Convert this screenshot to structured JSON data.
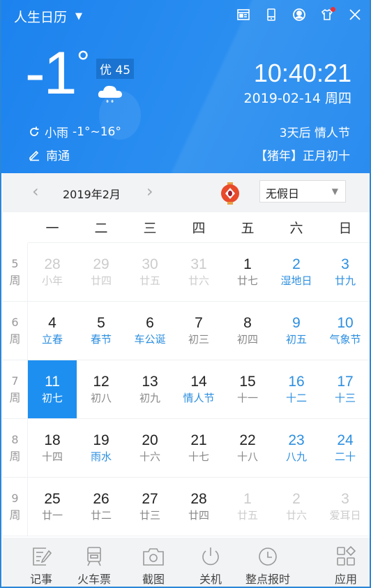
{
  "app": {
    "title": "人生日历",
    "menu_icon": "dropdown-triangle-icon"
  },
  "top_icons": [
    "news-icon",
    "mobile-icon",
    "user-icon",
    "skin-shirt-icon",
    "close-icon"
  ],
  "weather": {
    "temperature": "-1",
    "degree_symbol": "°",
    "aqi": "优 45",
    "condition": "小雨",
    "range": "-1°~16°",
    "location": "南通",
    "icon": "cloud-rain-icon"
  },
  "clock": {
    "time": "10:40:21",
    "date": "2019-02-14 周四",
    "upcoming": "3天后 情人节",
    "lunar": "【猪年】正月初十"
  },
  "nav": {
    "prev_label": "‹",
    "next_label": "›",
    "month": "2019年2月",
    "holiday_select": "无假日",
    "holiday_arrow": "▼"
  },
  "weekdays": [
    "一",
    "二",
    "三",
    "四",
    "五",
    "六",
    "日"
  ],
  "week_suffix": "周",
  "weeks": [
    {
      "num": "5",
      "days": [
        {
          "d": "28",
          "l": "小年",
          "t": "other"
        },
        {
          "d": "29",
          "l": "廿四",
          "t": "other"
        },
        {
          "d": "30",
          "l": "廿五",
          "t": "other"
        },
        {
          "d": "31",
          "l": "廿六",
          "t": "other"
        },
        {
          "d": "1",
          "l": "廿七",
          "t": "cur"
        },
        {
          "d": "2",
          "l": "湿地日",
          "t": "wkend"
        },
        {
          "d": "3",
          "l": "廿九",
          "t": "wkend"
        }
      ]
    },
    {
      "num": "6",
      "days": [
        {
          "d": "4",
          "l": "立春",
          "t": "cur fest"
        },
        {
          "d": "5",
          "l": "春节",
          "t": "cur fest"
        },
        {
          "d": "6",
          "l": "车公诞",
          "t": "cur fest"
        },
        {
          "d": "7",
          "l": "初三",
          "t": "cur"
        },
        {
          "d": "8",
          "l": "初四",
          "t": "cur"
        },
        {
          "d": "9",
          "l": "初五",
          "t": "wkend"
        },
        {
          "d": "10",
          "l": "气象节",
          "t": "wkend"
        }
      ]
    },
    {
      "num": "7",
      "days": [
        {
          "d": "11",
          "l": "初七",
          "t": "cur sel"
        },
        {
          "d": "12",
          "l": "初八",
          "t": "cur"
        },
        {
          "d": "13",
          "l": "初九",
          "t": "cur"
        },
        {
          "d": "14",
          "l": "情人节",
          "t": "cur fest"
        },
        {
          "d": "15",
          "l": "十一",
          "t": "cur"
        },
        {
          "d": "16",
          "l": "十二",
          "t": "wkend"
        },
        {
          "d": "17",
          "l": "十三",
          "t": "wkend"
        }
      ]
    },
    {
      "num": "8",
      "days": [
        {
          "d": "18",
          "l": "十四",
          "t": "cur"
        },
        {
          "d": "19",
          "l": "雨水",
          "t": "cur fest"
        },
        {
          "d": "20",
          "l": "十六",
          "t": "cur"
        },
        {
          "d": "21",
          "l": "十七",
          "t": "cur"
        },
        {
          "d": "22",
          "l": "十八",
          "t": "cur"
        },
        {
          "d": "23",
          "l": "八九",
          "t": "wkend"
        },
        {
          "d": "24",
          "l": "二十",
          "t": "wkend"
        }
      ]
    },
    {
      "num": "9",
      "days": [
        {
          "d": "25",
          "l": "廿一",
          "t": "cur"
        },
        {
          "d": "26",
          "l": "廿二",
          "t": "cur"
        },
        {
          "d": "27",
          "l": "廿三",
          "t": "cur"
        },
        {
          "d": "28",
          "l": "廿四",
          "t": "cur"
        },
        {
          "d": "1",
          "l": "廿五",
          "t": "other"
        },
        {
          "d": "2",
          "l": "廿六",
          "t": "other"
        },
        {
          "d": "3",
          "l": "爱耳日",
          "t": "other"
        }
      ]
    }
  ],
  "toolbar": [
    {
      "label": "记事",
      "icon": "note-edit-icon"
    },
    {
      "label": "火车票",
      "icon": "train-icon"
    },
    {
      "label": "截图",
      "icon": "camera-icon"
    },
    {
      "label": "关机",
      "icon": "power-icon"
    },
    {
      "label": "整点报时",
      "icon": "clock-icon"
    },
    {
      "label": "应用",
      "icon": "apps-grid-icon"
    }
  ],
  "colors": {
    "accent": "#1d8ff0",
    "header": "#2a8cf0",
    "weekend": "#2d8fe0"
  }
}
